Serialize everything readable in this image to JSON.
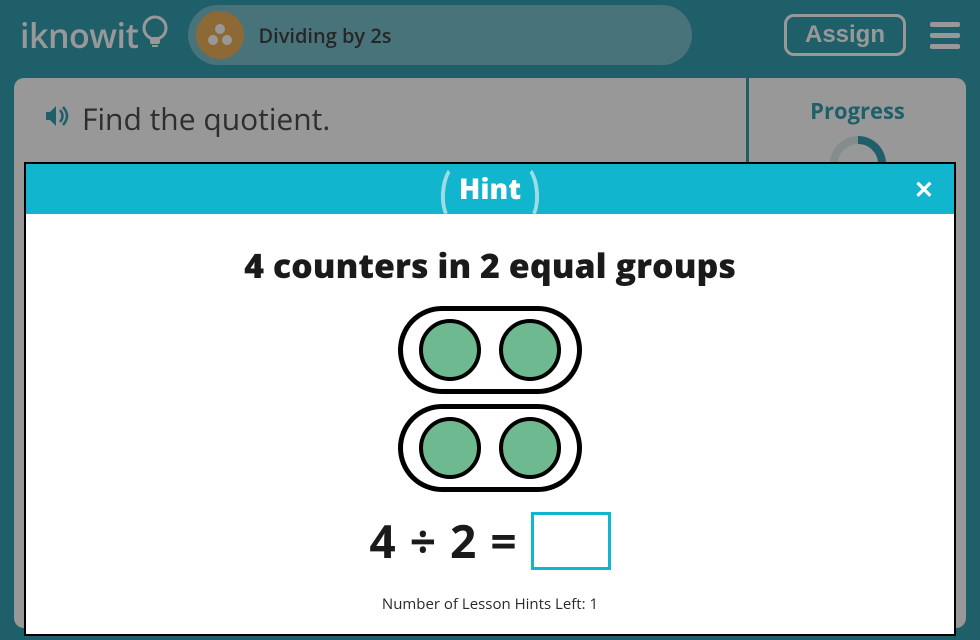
{
  "header": {
    "logo_text": "iknowit",
    "lesson_title": "Dividing by 2s",
    "assign_label": "Assign"
  },
  "question": {
    "prompt": "Find the quotient."
  },
  "sidebar": {
    "progress_label": "Progress"
  },
  "modal": {
    "title": "Hint",
    "hint_text": "4 counters in 2 equal groups",
    "equation": {
      "a": "4",
      "op": "÷",
      "b": "2",
      "eq": "="
    },
    "hints_left_label": "Number of Lesson Hints Left:",
    "hints_left_value": "1"
  }
}
